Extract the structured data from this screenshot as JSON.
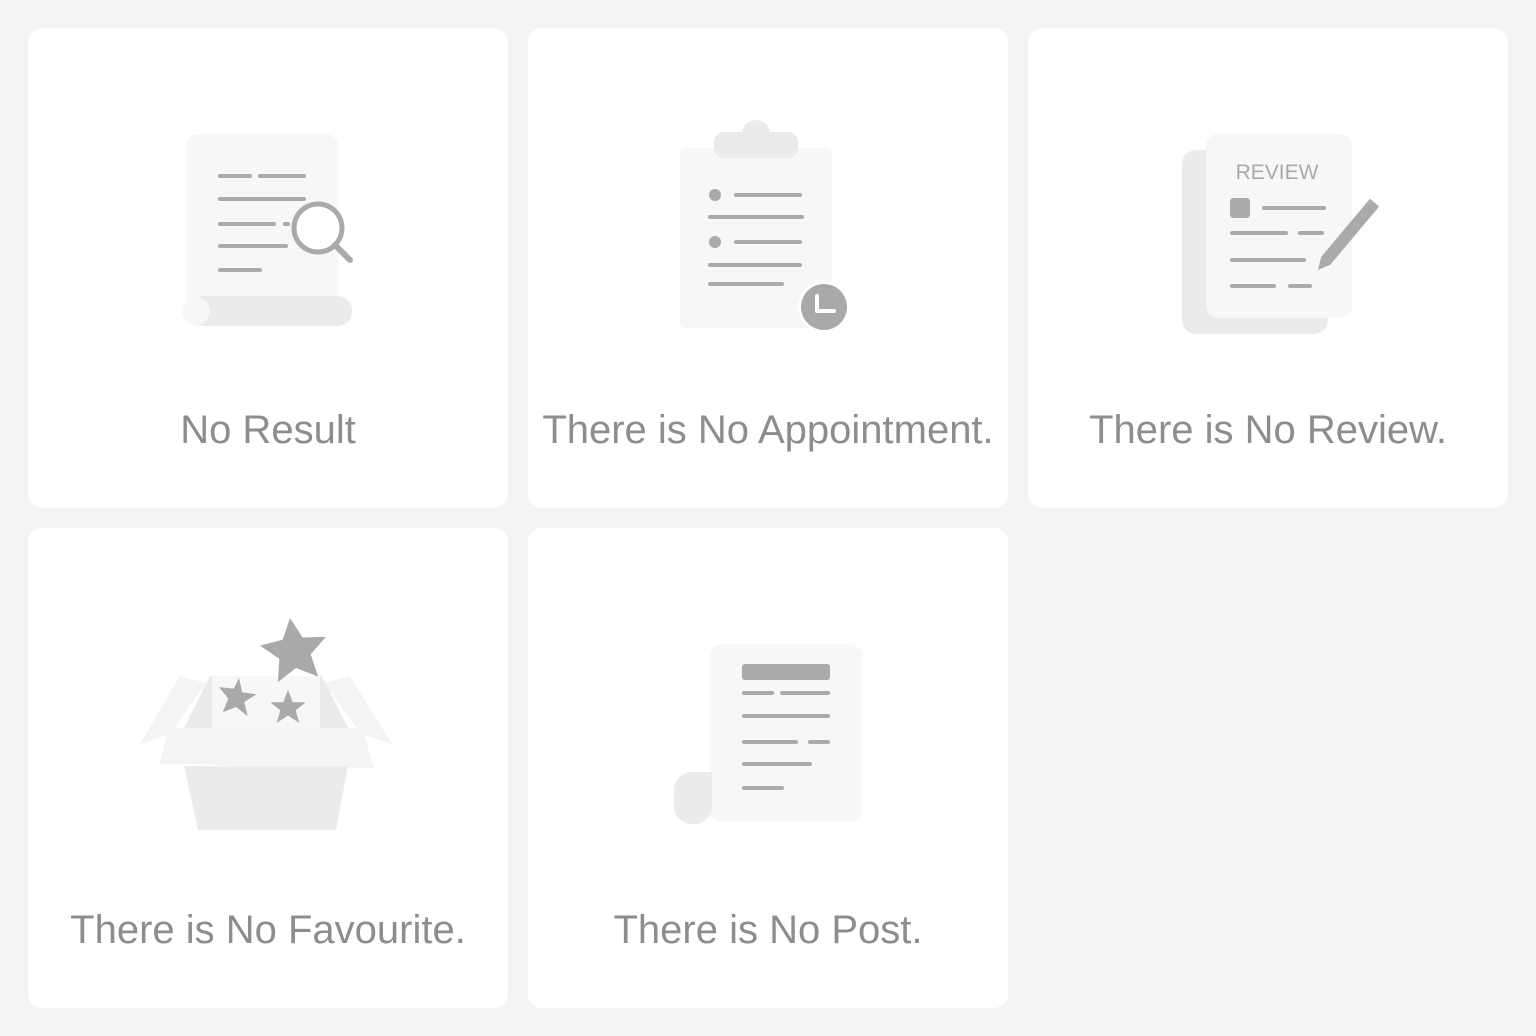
{
  "empty_states": [
    {
      "label": "No Result",
      "icon": "document-search-icon"
    },
    {
      "label": "There is No Appointment.",
      "icon": "clipboard-clock-icon"
    },
    {
      "label": "There is No Review.",
      "icon": "review-pencil-icon",
      "icon_text": "REVIEW"
    },
    {
      "label": "There is No Favourite.",
      "icon": "open-box-stars-icon"
    },
    {
      "label": "There is No Post.",
      "icon": "post-scroll-icon"
    }
  ],
  "colors": {
    "background": "#f4f4f4",
    "card": "#ffffff",
    "text": "#8d8d8d",
    "icon_dark": "#a9a9a9",
    "icon_light": "#ebebeb",
    "icon_paper": "#f7f7f7"
  }
}
